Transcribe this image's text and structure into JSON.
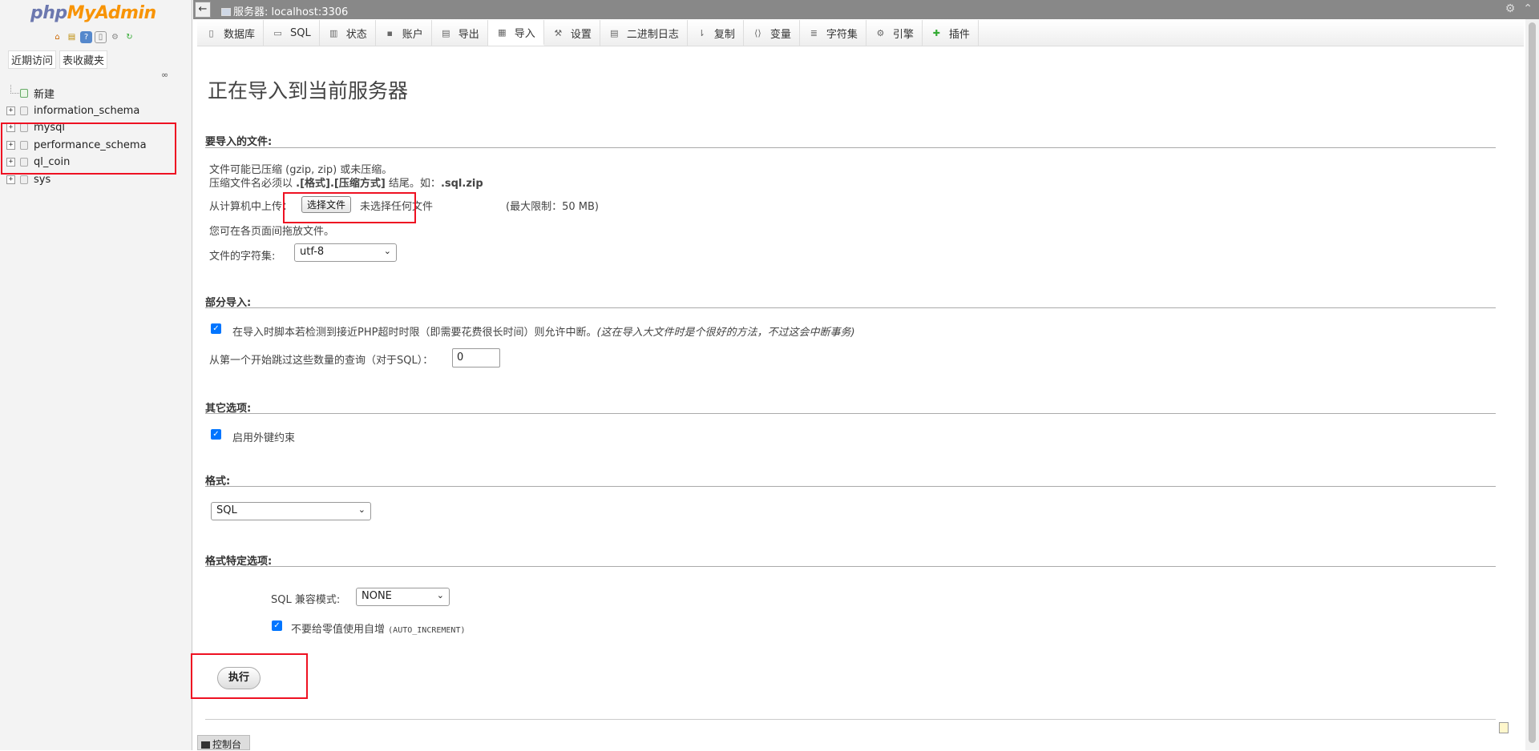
{
  "app": {
    "logo_php": "php",
    "logo_myadmin": "MyAdmin",
    "server_label": "服务器: localhost:3306"
  },
  "nav": {
    "tabs": [
      "近期访问",
      "表收藏夹"
    ],
    "tree": [
      {
        "label": "新建",
        "type": "new"
      },
      {
        "label": "information_schema",
        "type": "db"
      },
      {
        "label": "mysql",
        "type": "db"
      },
      {
        "label": "performance_schema",
        "type": "db"
      },
      {
        "label": "ql_coin",
        "type": "db"
      },
      {
        "label": "sys",
        "type": "db"
      }
    ]
  },
  "tabs": [
    {
      "label": "数据库",
      "icon": "database-icon"
    },
    {
      "label": "SQL",
      "icon": "sql-icon"
    },
    {
      "label": "状态",
      "icon": "status-icon"
    },
    {
      "label": "账户",
      "icon": "accounts-icon"
    },
    {
      "label": "导出",
      "icon": "export-icon"
    },
    {
      "label": "导入",
      "icon": "import-icon",
      "active": true
    },
    {
      "label": "设置",
      "icon": "wrench-icon"
    },
    {
      "label": "二进制日志",
      "icon": "binlog-icon"
    },
    {
      "label": "复制",
      "icon": "replication-icon"
    },
    {
      "label": "变量",
      "icon": "variables-icon"
    },
    {
      "label": "字符集",
      "icon": "charset-icon"
    },
    {
      "label": "引擎",
      "icon": "engine-icon"
    },
    {
      "label": "插件",
      "icon": "plugin-icon"
    }
  ],
  "main": {
    "title": "正在导入到当前服务器",
    "file_section": {
      "title": "要导入的文件:",
      "note1": "文件可能已压缩 (gzip, zip) 或未压缩。",
      "note2_prefix": "压缩文件名必须以 ",
      "note2_bold": ".[格式].[压缩方式]",
      "note2_mid": " 结尾。如：",
      "note2_example": ".sql.zip",
      "upload_label": "从计算机中上传：",
      "choose_button": "选择文件",
      "no_file": "未选择任何文件",
      "max_limit": "(最大限制：50 MB)",
      "drag_hint": "您可在各页面间拖放文件。",
      "charset_label": "文件的字符集:",
      "charset_value": "utf-8"
    },
    "partial_section": {
      "title": "部分导入:",
      "allow_interrupt_checked": true,
      "allow_interrupt_label": "在导入时脚本若检测到接近PHP超时时限（即需要花费很长时间）则允许中断。",
      "allow_interrupt_hint": "(这在导入大文件时是个很好的方法，不过这会中断事务)",
      "skip_label": "从第一个开始跳过这些数量的查询（对于SQL）：",
      "skip_value": "0"
    },
    "other_section": {
      "title": "其它选项:",
      "fk_checked": true,
      "fk_label": "启用外键约束"
    },
    "format_section": {
      "title": "格式:",
      "format_value": "SQL"
    },
    "format_options_section": {
      "title": "格式特定选项:",
      "sql_compat_label": "SQL 兼容模式:",
      "sql_compat_value": "NONE",
      "no_auto_value_checked": true,
      "no_auto_value_label": "不要给零值使用自增",
      "no_auto_value_code": "(AUTO_INCREMENT)"
    },
    "execute_button": "执行"
  },
  "console_label": "控制台",
  "colors": {
    "highlight": "#ee1122",
    "logo_php": "#6c78af",
    "logo_myadmin": "#f89406",
    "checkbox": "#0075ff"
  }
}
